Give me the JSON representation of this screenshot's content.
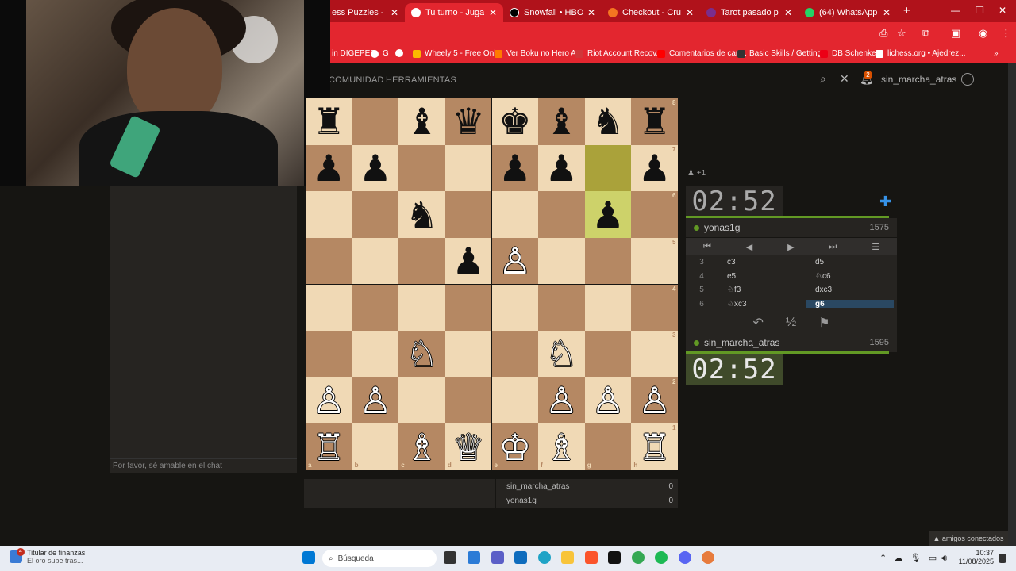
{
  "browser": {
    "tabs": [
      {
        "title": "ess Puzzles - Impro",
        "active": false,
        "fav_color": "#ffffff"
      },
      {
        "title": "Tu turno - Jugar yona",
        "active": true,
        "fav_color": "#ffffff"
      },
      {
        "title": "Snowfall • HBO Max",
        "active": false,
        "fav_color": "#000000"
      },
      {
        "title": "Checkout - Crunchyro",
        "active": false,
        "fav_color": "#f47521"
      },
      {
        "title": "Tarot pasado present",
        "active": false,
        "fav_color": "#7a2d8c"
      },
      {
        "title": "(64) WhatsApp",
        "active": false,
        "fav_color": "#25d366"
      }
    ],
    "new_tab": "+",
    "window_controls": [
      "—",
      "❐",
      "✕"
    ],
    "bookmarks": [
      {
        "label": "in DIGEPEP",
        "fav_color": "#ffffff"
      },
      {
        "label": "G",
        "fav_color": "#4285f4"
      },
      {
        "label": "",
        "fav_color": "#ffffff"
      },
      {
        "label": "Wheely 5 - Free Onl...",
        "fav_color": "#fcb900"
      },
      {
        "label": "Ver Boku no Hero A...",
        "fav_color": "#ff7a00"
      },
      {
        "label": "Riot Account Recov...",
        "fav_color": "#d13639"
      },
      {
        "label": "Comentarios de can...",
        "fav_color": "#ff0000"
      },
      {
        "label": "Basic Skills / Getting...",
        "fav_color": "#333333"
      },
      {
        "label": "DB Schenker",
        "fav_color": "#ec0016"
      },
      {
        "label": "lichess.org • Ajedrez...",
        "fav_color": "#ffffff"
      }
    ],
    "more_bookmarks": "»"
  },
  "site": {
    "nav": [
      "COMUNIDAD",
      "HERRAMIENTAS"
    ],
    "notif_count": "2",
    "username": "sin_marcha_atras"
  },
  "chat": {
    "placeholder": "Por favor, sé amable en el chat"
  },
  "board": {
    "files": [
      "a",
      "b",
      "c",
      "d",
      "e",
      "f",
      "g",
      "h"
    ],
    "ranks": [
      "8",
      "7",
      "6",
      "5",
      "4",
      "3",
      "2",
      "1"
    ],
    "pieces": [
      {
        "sq": "a8",
        "p": "♜",
        "c": "b"
      },
      {
        "sq": "c8",
        "p": "♝",
        "c": "b"
      },
      {
        "sq": "d8",
        "p": "♛",
        "c": "b"
      },
      {
        "sq": "e8",
        "p": "♚",
        "c": "b"
      },
      {
        "sq": "f8",
        "p": "♝",
        "c": "b"
      },
      {
        "sq": "g8",
        "p": "♞",
        "c": "b"
      },
      {
        "sq": "h8",
        "p": "♜",
        "c": "b"
      },
      {
        "sq": "a7",
        "p": "♟",
        "c": "b"
      },
      {
        "sq": "b7",
        "p": "♟",
        "c": "b"
      },
      {
        "sq": "e7",
        "p": "♟",
        "c": "b"
      },
      {
        "sq": "f7",
        "p": "♟",
        "c": "b"
      },
      {
        "sq": "h7",
        "p": "♟",
        "c": "b"
      },
      {
        "sq": "c6",
        "p": "♞",
        "c": "b"
      },
      {
        "sq": "g6",
        "p": "♟",
        "c": "b"
      },
      {
        "sq": "d5",
        "p": "♟",
        "c": "b"
      },
      {
        "sq": "e5",
        "p": "♙",
        "c": "w"
      },
      {
        "sq": "c3",
        "p": "♘",
        "c": "w"
      },
      {
        "sq": "f3",
        "p": "♘",
        "c": "w"
      },
      {
        "sq": "a2",
        "p": "♙",
        "c": "w"
      },
      {
        "sq": "b2",
        "p": "♙",
        "c": "w"
      },
      {
        "sq": "f2",
        "p": "♙",
        "c": "w"
      },
      {
        "sq": "g2",
        "p": "♙",
        "c": "w"
      },
      {
        "sq": "h2",
        "p": "♙",
        "c": "w"
      },
      {
        "sq": "a1",
        "p": "♖",
        "c": "w"
      },
      {
        "sq": "c1",
        "p": "♗",
        "c": "w"
      },
      {
        "sq": "d1",
        "p": "♕",
        "c": "w"
      },
      {
        "sq": "e1",
        "p": "♔",
        "c": "w"
      },
      {
        "sq": "f1",
        "p": "♗",
        "c": "w"
      },
      {
        "sq": "h1",
        "p": "♖",
        "c": "w"
      }
    ],
    "last_move": [
      "g7",
      "g6"
    ]
  },
  "game": {
    "spectators": "+1",
    "top_player": {
      "name": "yonas1g",
      "rating": "1575",
      "clock": "02:52"
    },
    "bottom_player": {
      "name": "sin_marcha_atras",
      "rating": "1595",
      "clock": "02:52"
    },
    "moves": [
      {
        "n": "3",
        "w": "c3",
        "b": "d5"
      },
      {
        "n": "4",
        "w": "e5",
        "b": "♘c6"
      },
      {
        "n": "5",
        "w": "♘f3",
        "b": "dxc3"
      },
      {
        "n": "6",
        "w": "♘xc3",
        "b": "g6"
      }
    ],
    "current_move": "g6",
    "nav_buttons": [
      "⏮",
      "◀",
      "▶",
      "⏭",
      "☰"
    ],
    "actions": [
      "↶",
      "½",
      "⚑"
    ]
  },
  "score": [
    {
      "name": "sin_marcha_atras",
      "pts": "0"
    },
    {
      "name": "yonas1g",
      "pts": "0"
    }
  ],
  "friends": "▲ amigos conectados",
  "taskbar": {
    "widget_title": "Titular de finanzas",
    "widget_sub": "El oro sube tras...",
    "widget_badge": "4",
    "search": "Búsqueda",
    "time": "10:37",
    "date": "11/08/2025"
  },
  "colors": {
    "accent_red": "#e3262f",
    "board_light": "#f0d9b5",
    "board_dark": "#b58863",
    "highlight_green": "#629924",
    "current_move_bg": "#2a4862"
  }
}
